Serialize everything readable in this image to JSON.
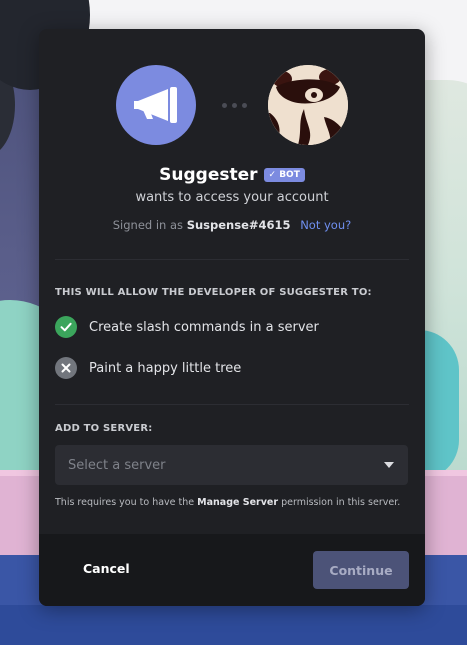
{
  "colors": {
    "modal_bg": "#1f2024",
    "accent": "#7c8be0",
    "link": "#6f8ff0",
    "check_green": "#3ba55c",
    "cross_grey": "#72767d",
    "continue_disabled": "#4c5378"
  },
  "app": {
    "name": "Suggester",
    "badge": "✓ BOT",
    "subtitle": "wants to access your account",
    "avatar_icon": "megaphone-icon"
  },
  "account": {
    "signed_in_prefix": "Signed in as",
    "username": "Suspense#4615",
    "not_you": "Not you?"
  },
  "permissions": {
    "title": "THIS WILL ALLOW THE DEVELOPER OF SUGGESTER TO:",
    "items": [
      {
        "label": "Create slash commands in a server",
        "icon": "check-icon"
      },
      {
        "label": "Paint a happy little tree",
        "icon": "cross-icon"
      }
    ]
  },
  "server": {
    "title": "ADD TO SERVER:",
    "placeholder": "Select a server",
    "note_prefix": "This requires you to have the",
    "note_bold": "Manage Server",
    "note_suffix": "permission in this server."
  },
  "footer": {
    "cancel": "Cancel",
    "continue": "Continue"
  }
}
